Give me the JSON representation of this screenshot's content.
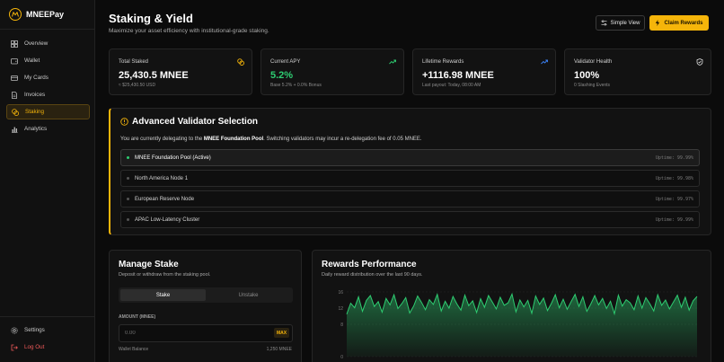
{
  "brand": {
    "name": "MNEEPay"
  },
  "sidebar": {
    "items": [
      {
        "label": "Overview",
        "icon": "grid-icon"
      },
      {
        "label": "Wallet",
        "icon": "wallet-icon"
      },
      {
        "label": "My Cards",
        "icon": "card-icon"
      },
      {
        "label": "Invoices",
        "icon": "document-icon"
      },
      {
        "label": "Staking",
        "icon": "coins-icon",
        "active": true
      },
      {
        "label": "Analytics",
        "icon": "bar-chart-icon"
      }
    ],
    "bottom": [
      {
        "label": "Settings",
        "icon": "gear-icon"
      },
      {
        "label": "Log Out",
        "icon": "logout-icon"
      }
    ]
  },
  "header": {
    "title": "Staking & Yield",
    "subtitle": "Maximize your asset efficiency with institutional-grade staking.",
    "simple_view_label": "Simple View",
    "claim_label": "Claim Rewards"
  },
  "stats": [
    {
      "label": "Total Staked",
      "value": "25,430.5 MNEE",
      "sub": "≈ $25,430.50 USD",
      "icon": "coins-icon"
    },
    {
      "label": "Current APY",
      "value": "5.2%",
      "sub": "Base 5.2% + 0.0% Bonus",
      "icon": "trend-up-icon"
    },
    {
      "label": "Lifetime Rewards",
      "value": "+1116.98 MNEE",
      "sub": "Last payout: Today, 08:00 AM",
      "icon": "trend-up-icon"
    },
    {
      "label": "Validator Health",
      "value": "100%",
      "sub": "0 Slashing Events",
      "icon": "shield-icon"
    }
  ],
  "validator": {
    "title": "Advanced Validator Selection",
    "desc_prefix": "You are currently delegating to the ",
    "desc_pool": "MNEE Foundation Pool",
    "desc_suffix": ". Switching validators may incur a re-delegation fee of 0.05 MNEE.",
    "rows": [
      {
        "name": "MNEE Foundation Pool (Active)",
        "uptime": "Uptime: 99.99%",
        "selected": true
      },
      {
        "name": "North America Node 1",
        "uptime": "Uptime: 99.98%"
      },
      {
        "name": "European Reserve Node",
        "uptime": "Uptime: 99.97%"
      },
      {
        "name": "APAC Low-Latency Cluster",
        "uptime": "Uptime: 99.99%"
      }
    ]
  },
  "manage": {
    "title": "Manage Stake",
    "subtitle": "Deposit or withdraw from the staking pool.",
    "tab_stake": "Stake",
    "tab_unstake": "Unstake",
    "amount_label": "AMOUNT (MNEE)",
    "amount_placeholder": "0.00",
    "max_label": "MAX",
    "wallet_label": "Wallet Balance",
    "wallet_value": "1,250 MNEE"
  },
  "rewards": {
    "title": "Rewards Performance",
    "subtitle": "Daily reward distribution over the last 90 days."
  },
  "chart_data": {
    "type": "area",
    "title": "Rewards Performance",
    "ylim": [
      0,
      16
    ],
    "yticks": [
      "16",
      "12",
      "8",
      "0"
    ],
    "color": "#2ecc71",
    "values": [
      10.5,
      13.2,
      12.1,
      14.8,
      11.2,
      13.9,
      15.1,
      12.4,
      13.6,
      11.0,
      14.4,
      12.8,
      15.3,
      11.9,
      13.1,
      14.6,
      10.8,
      12.5,
      15.0,
      13.4,
      11.6,
      14.1,
      12.9,
      15.4,
      11.3,
      13.7,
      12.0,
      14.9,
      13.0,
      11.5,
      15.2,
      12.6,
      13.8,
      10.9,
      14.3,
      12.2,
      15.1,
      13.5,
      11.8,
      14.7,
      12.7,
      13.3,
      15.5,
      11.1,
      14.0,
      12.3,
      13.9,
      10.7,
      15.0,
      12.9,
      14.5,
      11.4,
      13.2,
      15.3,
      12.1,
      14.2,
      11.7,
      13.6,
      15.4,
      12.4,
      14.8,
      11.2,
      13.0,
      15.1,
      12.8,
      14.4,
      11.9,
      13.7,
      10.6,
      15.2,
      12.5,
      14.1,
      13.3,
      11.6,
      15.0,
      12.0,
      14.6,
      13.1,
      11.3,
      15.3,
      12.7,
      14.0,
      11.8,
      13.5,
      15.2,
      12.2,
      14.7,
      11.5,
      13.8,
      14.9
    ]
  }
}
